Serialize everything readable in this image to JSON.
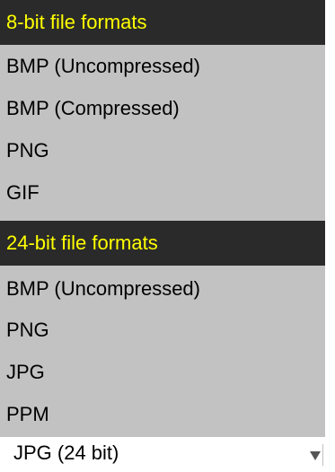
{
  "dropdown": {
    "groups": [
      {
        "header": "8-bit file formats",
        "items": [
          "BMP (Uncompressed)",
          "BMP (Compressed)",
          "PNG",
          "GIF"
        ]
      },
      {
        "header": "24-bit file formats",
        "items": [
          "BMP (Uncompressed)",
          "PNG",
          "JPG",
          "PPM"
        ]
      }
    ],
    "selected_value": "JPG (24 bit)",
    "colors": {
      "list_background": "#c2c2c2",
      "header_background": "#2a2a2a",
      "header_text": "#ffff00"
    }
  }
}
